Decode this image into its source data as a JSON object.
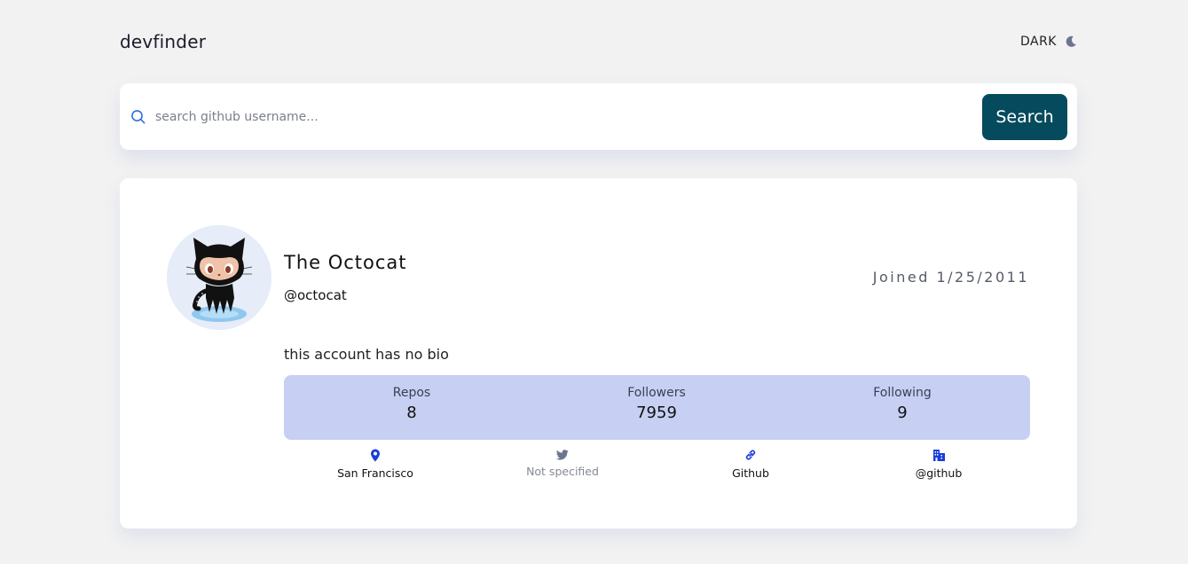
{
  "header": {
    "logo": "devfinder",
    "theme_toggle_label": "DARK",
    "theme_icon": "moon-icon"
  },
  "search": {
    "placeholder": "search github username...",
    "button_label": "Search",
    "icon": "search-icon"
  },
  "profile": {
    "name": "The Octocat",
    "login": "@octocat",
    "joined": "Joined 1/25/2011",
    "bio": "this account has no bio",
    "stats": [
      {
        "label": "Repos",
        "value": "8"
      },
      {
        "label": "Followers",
        "value": "7959"
      },
      {
        "label": "Following",
        "value": "9"
      }
    ],
    "links": [
      {
        "icon": "location-pin-icon",
        "text": "San Francisco"
      },
      {
        "icon": "twitter-icon",
        "text": "Not specified"
      },
      {
        "icon": "link-icon",
        "text": "Github"
      },
      {
        "icon": "building-icon",
        "text": "@github"
      }
    ]
  },
  "colors": {
    "background": "#f2f2f2",
    "card": "#ffffff",
    "accent_button": "#064a5d",
    "stats_background": "#c7d0f3",
    "link_icon_blue": "#1a3ddb",
    "muted_text": "#858995"
  }
}
